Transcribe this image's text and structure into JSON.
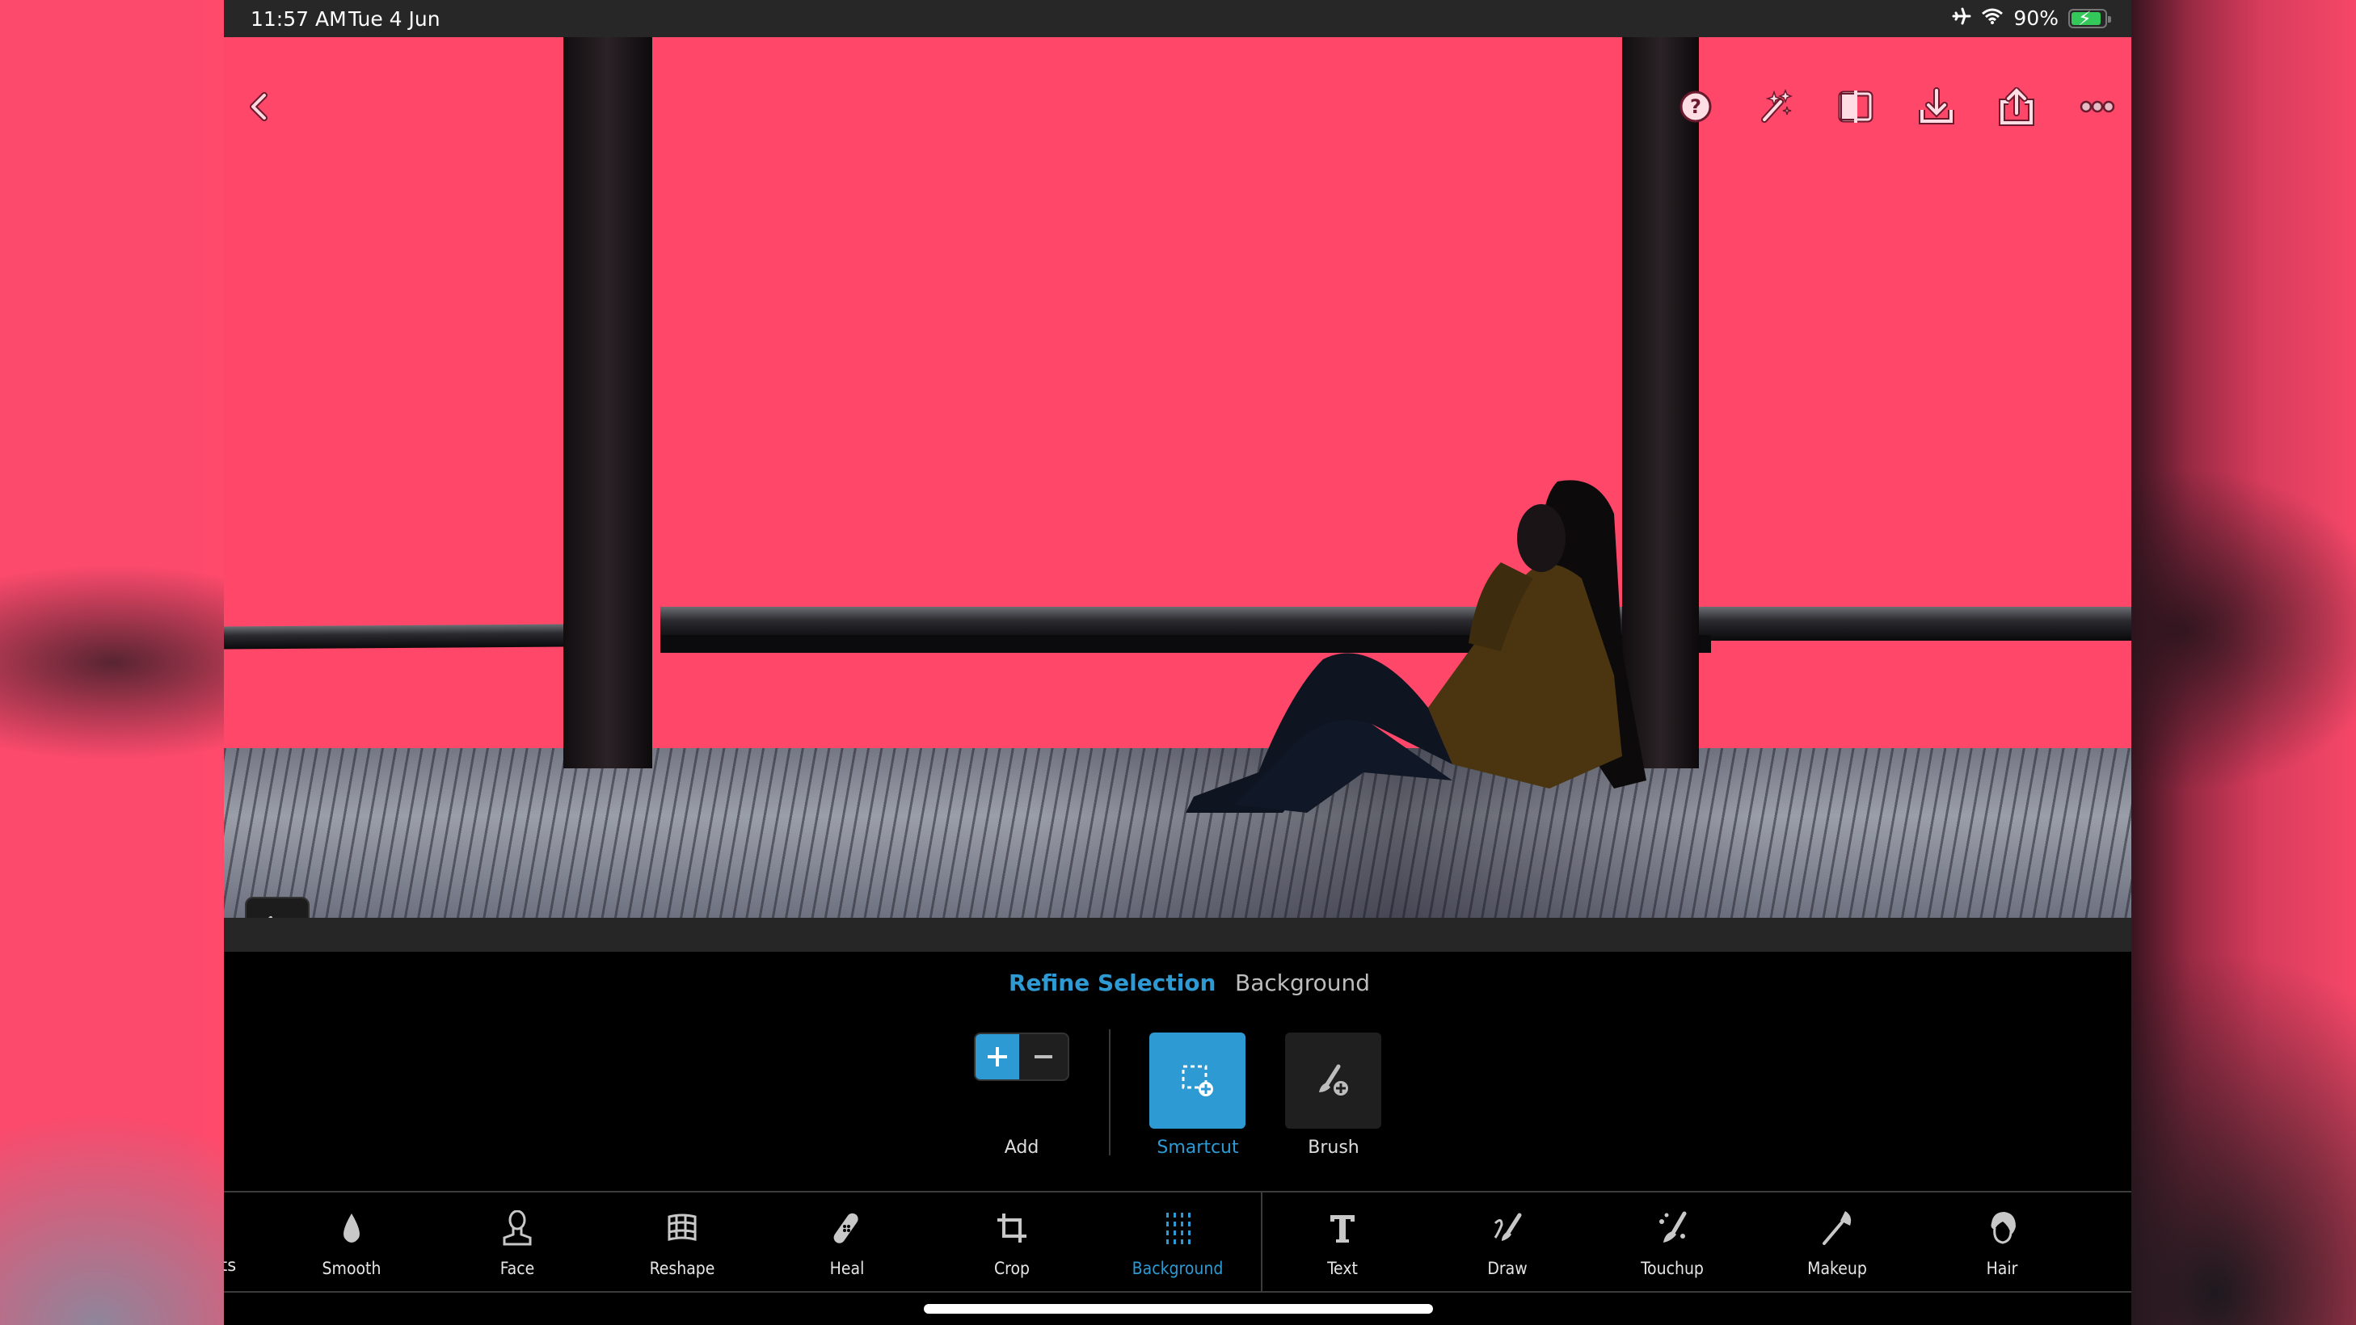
{
  "status_bar": {
    "time": "11:57 AM",
    "date": "Tue 4 Jun",
    "battery_percent": "90%",
    "icons": [
      "airplane-icon",
      "wifi-icon",
      "battery-charging-icon"
    ]
  },
  "top_bar": {
    "left": [
      "back-chevron-icon"
    ],
    "right": [
      "help-icon",
      "magic-wand-icon",
      "compare-icon",
      "download-icon",
      "share-icon",
      "more-icon"
    ]
  },
  "canvas": {
    "overlay_color": "#ff4769",
    "undo_icon": "undo-icon"
  },
  "panel": {
    "tabs": [
      {
        "label": "Refine Selection",
        "active": true
      },
      {
        "label": "Background",
        "active": false
      }
    ],
    "mode": {
      "label": "Add",
      "add_symbol": "+",
      "subtract_symbol": "−",
      "selected": "add"
    },
    "tools": [
      {
        "label": "Smartcut",
        "icon": "smartcut-icon",
        "active": true
      },
      {
        "label": "Brush",
        "icon": "brush-add-icon",
        "active": false
      }
    ]
  },
  "toolbar": {
    "partial_item_label": "ts",
    "items": [
      {
        "label": "Smooth",
        "icon": "drop-icon"
      },
      {
        "label": "Face",
        "icon": "face-icon"
      },
      {
        "label": "Reshape",
        "icon": "grid-warp-icon"
      },
      {
        "label": "Heal",
        "icon": "bandage-icon"
      },
      {
        "label": "Crop",
        "icon": "crop-icon"
      },
      {
        "label": "Background",
        "icon": "dots-grid-icon",
        "active": true
      },
      {
        "label": "Text",
        "icon": "text-icon"
      },
      {
        "label": "Draw",
        "icon": "draw-icon"
      },
      {
        "label": "Touchup",
        "icon": "touchup-icon"
      },
      {
        "label": "Makeup",
        "icon": "makeup-brush-icon"
      },
      {
        "label": "Hair",
        "icon": "hair-icon"
      }
    ]
  },
  "colors": {
    "accent": "#2d9ad4",
    "status_bar_bg": "#272727",
    "battery_green": "#34c759"
  }
}
